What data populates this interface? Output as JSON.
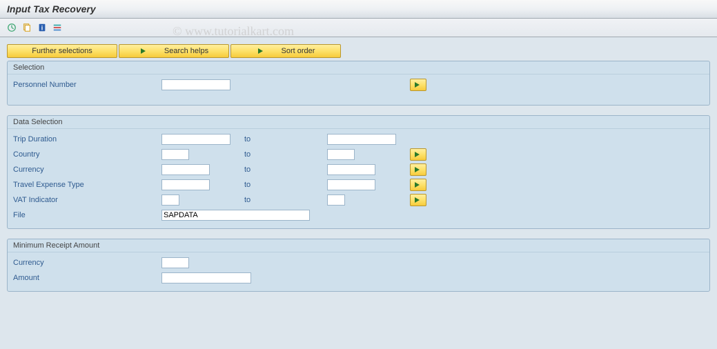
{
  "title": "Input Tax Recovery",
  "watermark": "© www.tutorialkart.com",
  "topButtons": {
    "further": "Further selections",
    "search": "Search helps",
    "sort": "Sort order"
  },
  "groups": {
    "selection": {
      "title": "Selection",
      "personnel": {
        "label": "Personnel Number",
        "value": ""
      }
    },
    "dataSelection": {
      "title": "Data Selection",
      "tripDuration": {
        "label": "Trip Duration",
        "from": "",
        "toLabel": "to",
        "to": ""
      },
      "country": {
        "label": "Country",
        "from": "",
        "toLabel": "to",
        "to": ""
      },
      "currency": {
        "label": "Currency",
        "from": "",
        "toLabel": "to",
        "to": ""
      },
      "travelExpType": {
        "label": "Travel Expense Type",
        "from": "",
        "toLabel": "to",
        "to": ""
      },
      "vatIndicator": {
        "label": "VAT Indicator",
        "from": "",
        "toLabel": "to",
        "to": ""
      },
      "file": {
        "label": "File",
        "value": "SAPDATA"
      }
    },
    "minReceipt": {
      "title": "Minimum Receipt Amount",
      "currency": {
        "label": "Currency",
        "value": ""
      },
      "amount": {
        "label": "Amount",
        "value": ""
      }
    }
  }
}
